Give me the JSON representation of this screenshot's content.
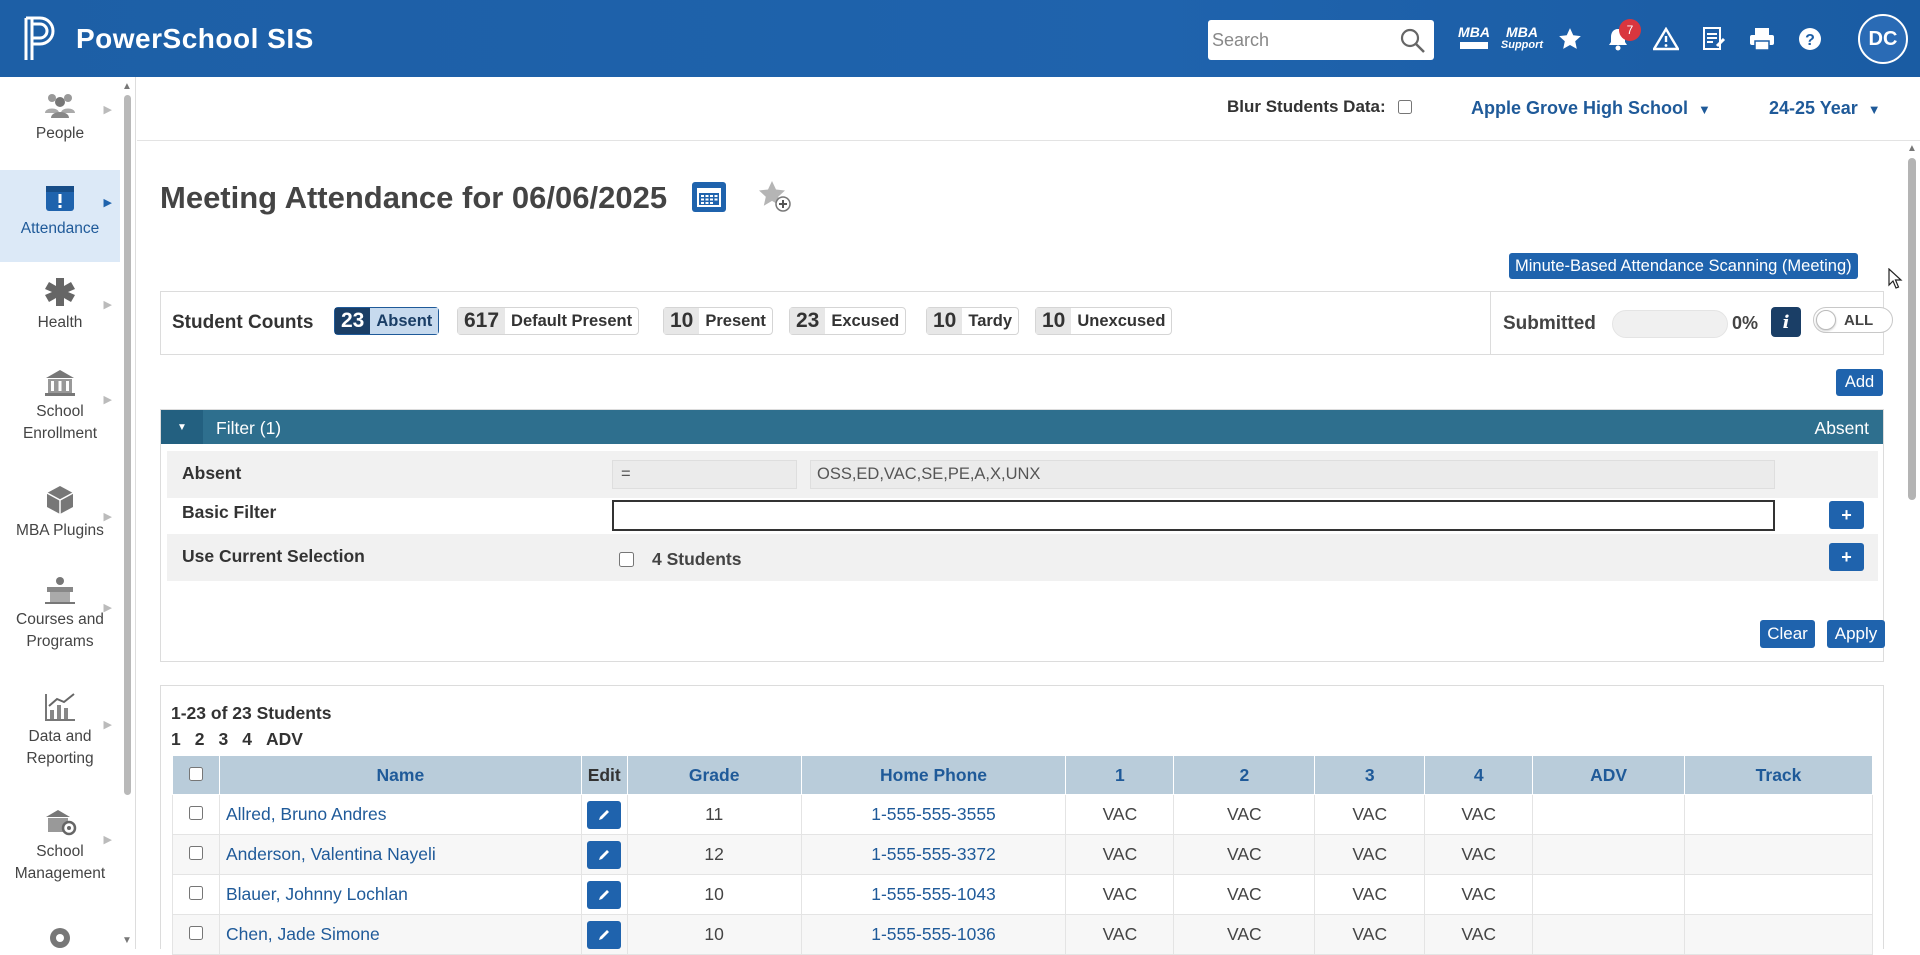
{
  "app": {
    "title": "PowerSchool SIS"
  },
  "search": {
    "placeholder": "Search"
  },
  "header_icons": {
    "mba_1": "MBA",
    "mba_2_top": "MBA",
    "mba_2_bottom": "Support",
    "notification_count": "7",
    "avatar_initials": "DC"
  },
  "nav": {
    "items": [
      {
        "label": "People",
        "icon": "people-icon"
      },
      {
        "label": "Attendance",
        "icon": "attendance-icon"
      },
      {
        "label": "Health",
        "icon": "health-icon"
      },
      {
        "label": "School Enrollment",
        "icon": "school-enrollment-icon"
      },
      {
        "label": "MBA Plugins",
        "icon": "plugin-box-icon"
      },
      {
        "label": "Courses and Programs",
        "icon": "courses-icon"
      },
      {
        "label": "Data and Reporting",
        "icon": "chart-icon"
      },
      {
        "label": "School Management",
        "icon": "school-management-icon"
      }
    ]
  },
  "subheader": {
    "blur_label": "Blur Students Data:",
    "school": "Apple Grove High School",
    "year": "24-25 Year"
  },
  "page": {
    "title": "Meeting Attendance for 06/06/2025",
    "mba_scan_button": "Minute-Based Attendance Scanning (Meeting)",
    "add_button": "Add"
  },
  "counts": {
    "label": "Student Counts",
    "chips": [
      {
        "num": "23",
        "label": "Absent",
        "selected": true
      },
      {
        "num": "617",
        "label": "Default Present",
        "selected": false
      },
      {
        "num": "10",
        "label": "Present",
        "selected": false
      },
      {
        "num": "23",
        "label": "Excused",
        "selected": false
      },
      {
        "num": "10",
        "label": "Tardy",
        "selected": false
      },
      {
        "num": "10",
        "label": "Unexcused",
        "selected": false
      }
    ],
    "submitted_label": "Submitted",
    "submitted_fraction": 0,
    "submitted_pct": "0%",
    "toggle_label": "ALL"
  },
  "filter": {
    "title": "Filter (1)",
    "right_label": "Absent",
    "rows": {
      "absent_label": "Absent",
      "absent_op": "=",
      "absent_value": "OSS,ED,VAC,SE,PE,A,X,UNX",
      "basic_label": "Basic Filter",
      "current_label": "Use Current Selection",
      "current_students": "4 Students"
    },
    "clear": "Clear",
    "apply": "Apply"
  },
  "results": {
    "count_text": "1-23 of 23 Students",
    "pages": [
      "1",
      "2",
      "3",
      "4",
      "ADV"
    ],
    "columns": [
      "Name",
      "Edit",
      "Grade",
      "Home Phone",
      "1",
      "2",
      "3",
      "4",
      "ADV",
      "Track"
    ],
    "rows": [
      {
        "name": "Allred, Bruno Andres",
        "grade": "11",
        "phone": "1-555-555-3555",
        "p1": "VAC",
        "p2": "VAC",
        "p3": "VAC",
        "p4": "VAC",
        "adv": "",
        "track": ""
      },
      {
        "name": "Anderson, Valentina Nayeli",
        "grade": "12",
        "phone": "1-555-555-3372",
        "p1": "VAC",
        "p2": "VAC",
        "p3": "VAC",
        "p4": "VAC",
        "adv": "",
        "track": ""
      },
      {
        "name": "Blauer, Johnny Lochlan",
        "grade": "10",
        "phone": "1-555-555-1043",
        "p1": "VAC",
        "p2": "VAC",
        "p3": "VAC",
        "p4": "VAC",
        "adv": "",
        "track": ""
      },
      {
        "name": "Chen, Jade Simone",
        "grade": "10",
        "phone": "1-555-555-1036",
        "p1": "VAC",
        "p2": "VAC",
        "p3": "VAC",
        "p4": "VAC",
        "adv": "",
        "track": ""
      }
    ]
  },
  "colors": {
    "brand": "#1d5fa6",
    "filter_bar": "#2e6f8e",
    "table_header": "#b9ccda",
    "link": "#1f5a99"
  }
}
